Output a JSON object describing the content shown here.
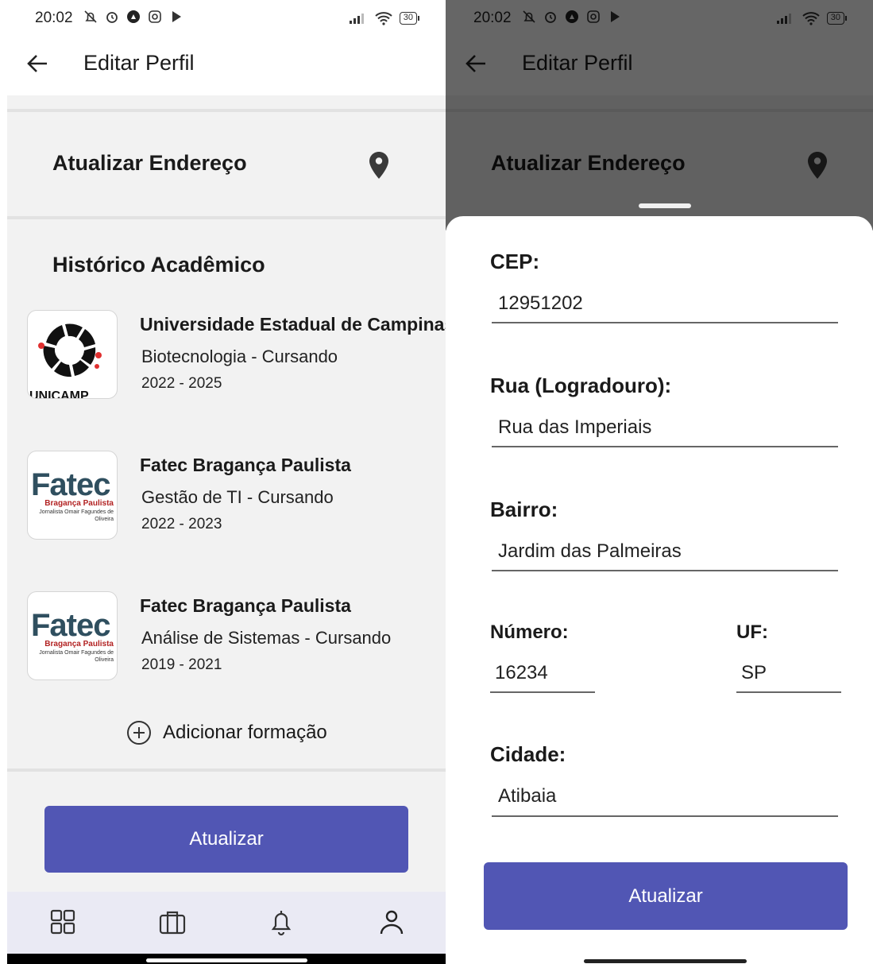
{
  "status": {
    "time": "20:02",
    "battery": "30"
  },
  "header": {
    "title": "Editar Perfil"
  },
  "address_section": {
    "title": "Atualizar Endereço"
  },
  "academic": {
    "title": "Histórico Acadêmico",
    "items": [
      {
        "institution": "Universidade Estadual de Campinas",
        "course": "Biotecnologia - Cursando",
        "years": "2022 - 2025",
        "logo": "unicamp-logo",
        "logo_text": "UNICAMP"
      },
      {
        "institution": "Fatec Bragança Paulista",
        "course": "Gestão de TI - Cursando",
        "years": "2022 - 2023",
        "logo": "fatec-logo",
        "logo_text": "Fatec",
        "logo_sub1": "Bragança Paulista",
        "logo_sub2": "Jornalista Omair Fagundes de Oliveira"
      },
      {
        "institution": "Fatec Bragança Paulista",
        "course": "Análise de Sistemas - Cursando",
        "years": "2019 - 2021",
        "logo": "fatec-logo",
        "logo_text": "Fatec",
        "logo_sub1": "Bragança Paulista",
        "logo_sub2": "Jornalista Omair Fagundes de Oliveira"
      }
    ],
    "add_label": "Adicionar formação"
  },
  "update_button": "Atualizar",
  "bottom_nav": [
    "grid-icon",
    "briefcase-icon",
    "bell-icon",
    "user-icon"
  ],
  "address_form": {
    "cep_label": "CEP:",
    "cep_value": "12951202",
    "street_label": "Rua (Logradouro):",
    "street_value": "Rua das Imperiais",
    "district_label": "Bairro:",
    "district_value": "Jardim das Palmeiras",
    "number_label": "Número:",
    "number_value": "16234",
    "uf_label": "UF:",
    "uf_value": "SP",
    "city_label": "Cidade:",
    "city_value": "Atibaia",
    "submit_label": "Atualizar"
  },
  "colors": {
    "primary": "#5156b4",
    "background": "#f2f2f2",
    "scrim": "rgba(0,0,0,0.6)"
  }
}
